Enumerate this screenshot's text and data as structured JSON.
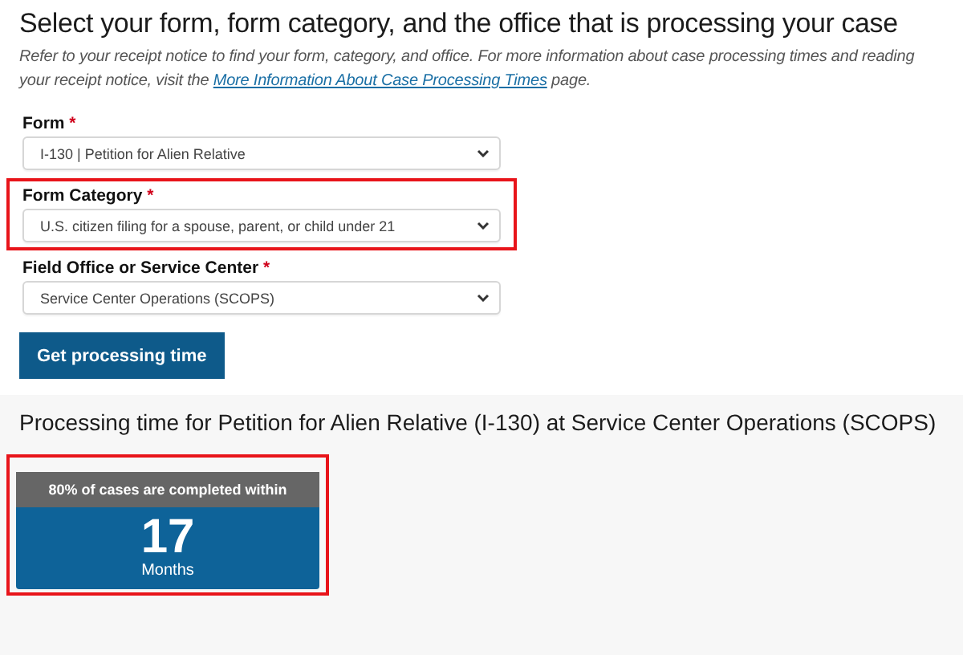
{
  "heading": "Select your form, form category, and the office that is processing your case",
  "intro": {
    "before": "Refer to your receipt notice to find your form, category, and office. For more information about case processing times and reading your receipt notice, visit the ",
    "link": "More Information About Case Processing Times",
    "after": " page."
  },
  "fields": [
    {
      "label": "Form",
      "required_mark": "*",
      "value": "I-130 | Petition for Alien Relative",
      "highlighted": false
    },
    {
      "label": "Form Category",
      "required_mark": "*",
      "value": "U.S. citizen filing for a spouse, parent, or child under 21",
      "highlighted": true
    },
    {
      "label": "Field Office or Service Center",
      "required_mark": "*",
      "value": "Service Center Operations (SCOPS)",
      "highlighted": false
    }
  ],
  "submit_button": "Get processing time",
  "result": {
    "heading": "Processing time for Petition for Alien Relative (I-130) at Service Center Operations (SCOPS)",
    "highlighted": true,
    "card_header": "80% of cases are completed within",
    "value": "17",
    "unit": "Months"
  }
}
